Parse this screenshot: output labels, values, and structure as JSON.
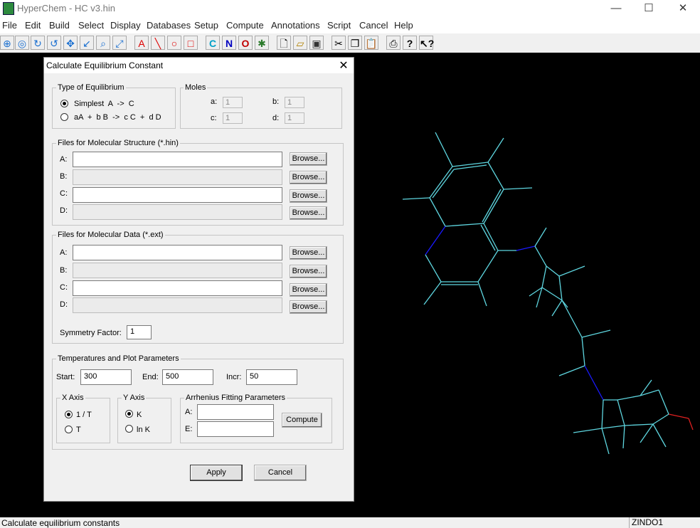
{
  "window": {
    "title": "HyperChem - HC v3.hin",
    "controls": [
      "—",
      "☐",
      "✕"
    ]
  },
  "menu": [
    "File",
    "Edit",
    "Build",
    "Select",
    "Display",
    "Databases",
    "Setup",
    "Compute",
    "Annotations",
    "Script",
    "Cancel",
    "Help"
  ],
  "toolbar": {
    "letter_buttons": [
      "C",
      "N",
      "O"
    ],
    "letter_colors": [
      "#00a0c8",
      "#0000c0",
      "#c00000"
    ]
  },
  "dialog": {
    "title": "Calculate Equilibrium Constant",
    "type_group": {
      "label": "Type of Equilibrium",
      "options": [
        "Simplest  A  ->  C",
        "aA  +  b B  ->  c C  +  d D"
      ],
      "selected": 0
    },
    "moles_group": {
      "label": "Moles",
      "a_label": "a:",
      "a_value": "1",
      "b_label": "b:",
      "b_value": "1",
      "c_label": "c:",
      "c_value": "1",
      "d_label": "d:",
      "d_value": "1"
    },
    "structure_group": {
      "label": "Files for Molecular Structure (*.hin)",
      "rows": [
        {
          "label": "A:",
          "value": "",
          "button": "Browse..."
        },
        {
          "label": "B:",
          "value": "",
          "button": "Browse..."
        },
        {
          "label": "C:",
          "value": "",
          "button": "Browse..."
        },
        {
          "label": "D:",
          "value": "",
          "button": "Browse..."
        }
      ]
    },
    "data_group": {
      "label": "Files for Molecular Data (*.ext)",
      "rows": [
        {
          "label": "A:",
          "value": "",
          "button": "Browse..."
        },
        {
          "label": "B:",
          "value": "",
          "button": "Browse..."
        },
        {
          "label": "C:",
          "value": "",
          "button": "Browse..."
        },
        {
          "label": "D:",
          "value": "",
          "button": "Browse..."
        }
      ],
      "symmetry_label": "Symmetry Factor:",
      "symmetry_value": "1"
    },
    "temp_group": {
      "label": "Temperatures and Plot Parameters",
      "start_label": "Start:",
      "start_value": "300",
      "end_label": "End:",
      "end_value": "500",
      "incr_label": "Incr:",
      "incr_value": "50",
      "xaxis": {
        "label": "X Axis",
        "options": [
          "1 / T",
          "T"
        ],
        "selected": 0
      },
      "yaxis": {
        "label": "Y Axis",
        "options": [
          "K",
          "ln K"
        ],
        "selected": 0
      },
      "arrhenius": {
        "label": "Arrhenius Fitting Parameters",
        "a_label": "A:",
        "a_value": "",
        "e_label": "E:",
        "e_value": "",
        "compute_button": "Compute"
      }
    },
    "apply_button": "Apply",
    "cancel_button": "Cancel"
  },
  "status": {
    "text": "Calculate equilibrium constants",
    "method": "ZINDO1"
  },
  "colors": {
    "bond": "#5ed6e0",
    "nitrogen": "#1a1aff",
    "oxygen": "#e02020"
  }
}
